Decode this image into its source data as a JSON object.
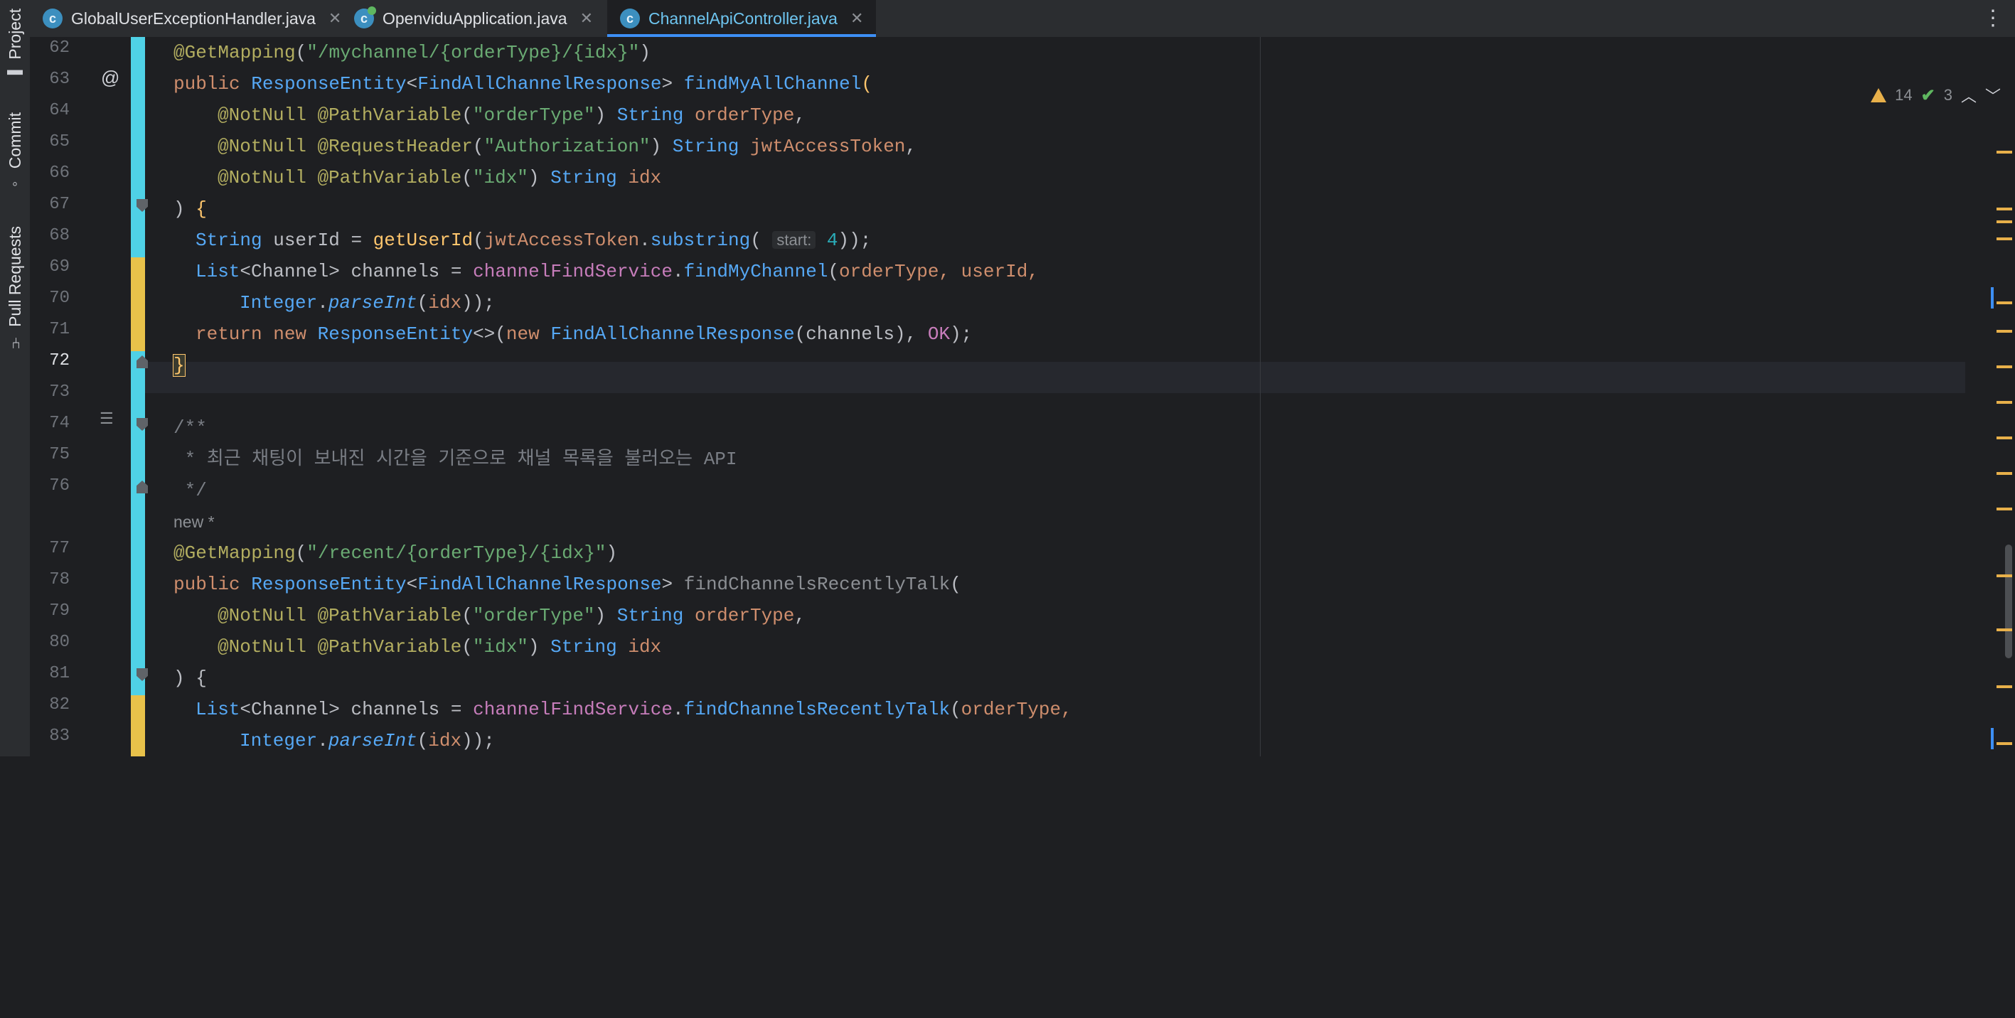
{
  "toolstrip": {
    "project": "Project",
    "commit": "Commit",
    "pull_requests": "Pull Requests"
  },
  "tabs": [
    {
      "label": "GlobalUserExceptionHandler.java",
      "active": false
    },
    {
      "label": "OpenviduApplication.java",
      "active": false
    },
    {
      "label": "ChannelApiController.java",
      "active": true
    }
  ],
  "inspection": {
    "warnings": "14",
    "ok": "3"
  },
  "gutter": {
    "line_numbers": [
      "62",
      "63",
      "64",
      "65",
      "66",
      "67",
      "68",
      "69",
      "70",
      "71",
      "72",
      "73",
      "74",
      "75",
      "76",
      "77",
      "78",
      "79",
      "80",
      "81",
      "82",
      "83"
    ],
    "current_line": "72"
  },
  "code": {
    "l62": {
      "ann": "@GetMapping",
      "open": "(",
      "str": "\"/mychannel/{orderType}/{idx}\"",
      "close": ")"
    },
    "l63": {
      "kw": "public ",
      "type": "ResponseEntity",
      "lt": "<",
      "type2": "FindAllChannelResponse",
      "gt": "> ",
      "fn": "findMyAllChannel",
      "rest": "("
    },
    "l64": {
      "a1": "@NotNull ",
      "a2": "@PathVariable",
      "p": "(",
      "s": "\"orderType\"",
      "p2": ") ",
      "t": "String ",
      "v": "orderType",
      "c": ","
    },
    "l65": {
      "a1": "@NotNull ",
      "a2": "@RequestHeader",
      "p": "(",
      "s": "\"Authorization\"",
      "p2": ") ",
      "t": "String ",
      "v": "jwtAccessToken",
      "c": ","
    },
    "l66": {
      "a1": "@NotNull ",
      "a2": "@PathVariable",
      "p": "(",
      "s": "\"idx\"",
      "p2": ") ",
      "t": "String ",
      "v": "idx"
    },
    "l67": {
      "t": ") ",
      "b": "{"
    },
    "l68": {
      "t": "String ",
      "v": "userId ",
      "eq": "= ",
      "fn": "getUserId",
      "p": "(",
      "v2": "jwtAccessToken",
      "dot": ".",
      "m": "substring",
      "p2": "( ",
      "hint": "start:",
      "n": " 4",
      "end": "));"
    },
    "l69": {
      "t": "List",
      "lt": "<",
      "t2": "Channel",
      "gt": "> ",
      "v": "channels ",
      "eq": "= ",
      "obj": "channelFindService",
      "dot": ".",
      "m": "findMyChannel",
      "p": "(",
      "a": "orderType, userId,"
    },
    "l70": {
      "t": "Integer",
      "dot": ".",
      "m": "parseInt",
      "p": "(",
      "a": "idx",
      "end": "));"
    },
    "l71": {
      "kw": "return new ",
      "t": "ResponseEntity",
      "d": "<>",
      "p": "(",
      "kw2": "new ",
      "t2": "FindAllChannelResponse",
      "p2": "(",
      "a": "channels",
      "p3": "), ",
      "c": "OK",
      "end": ");"
    },
    "l72": {
      "b": "}"
    },
    "l74": {
      "t": "/**"
    },
    "l75": {
      "t": " * 최근 채팅이 보내진 시간을 기준으로 채널 목록을 불러오는 API"
    },
    "l76": {
      "t": " */"
    },
    "codelens": "new *",
    "l77": {
      "ann": "@GetMapping",
      "open": "(",
      "str": "\"/recent/{orderType}/{idx}\"",
      "close": ")"
    },
    "l78": {
      "kw": "public ",
      "type": "ResponseEntity",
      "lt": "<",
      "type2": "FindAllChannelResponse",
      "gt": "> ",
      "fn": "findChannelsRecentlyTalk",
      "rest": "("
    },
    "l79": {
      "a1": "@NotNull ",
      "a2": "@PathVariable",
      "p": "(",
      "s": "\"orderType\"",
      "p2": ") ",
      "t": "String ",
      "v": "orderType",
      "c": ","
    },
    "l80": {
      "a1": "@NotNull ",
      "a2": "@PathVariable",
      "p": "(",
      "s": "\"idx\"",
      "p2": ") ",
      "t": "String ",
      "v": "idx"
    },
    "l81": {
      "t": ") ",
      "b": "{"
    },
    "l82": {
      "t": "List",
      "lt": "<",
      "t2": "Channel",
      "gt": "> ",
      "v": "channels ",
      "eq": "= ",
      "obj": "channelFindService",
      "dot": ".",
      "m": "findChannelsRecentlyTalk",
      "p": "(",
      "a": "orderType,"
    },
    "l83": {
      "t": "Integer",
      "dot": ".",
      "m": "parseInt",
      "p": "(",
      "a": "idx",
      "end": "));"
    }
  },
  "colors": {
    "accent": "#3d8ff5",
    "change_added": "#4fd1e6",
    "change_modified": "#e8c14a",
    "warning": "#e8b04a"
  },
  "icons": {
    "java_file": "java-class-icon",
    "close": "close-icon",
    "more": "more-vertical-icon"
  }
}
